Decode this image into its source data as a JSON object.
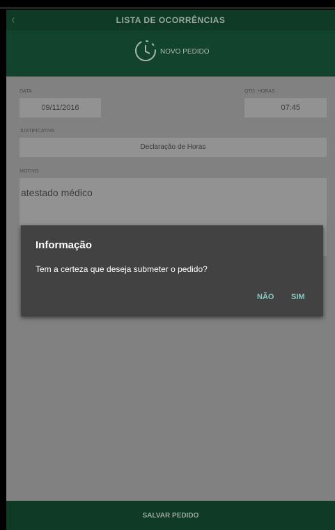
{
  "app": {
    "title": "LISTA DE OCORRÊNCIAS",
    "back_icon": "chevron-left-icon",
    "new_request_label": "NOVO PEDIDO",
    "new_request_icon": "clock-icon"
  },
  "form": {
    "date_label": "DATA",
    "date_value": "09/11/2016",
    "hours_label": "QTD. HORAS",
    "hours_value": "07:45",
    "justification_label": "JUSTIFICATIVA",
    "justification_value": "Declaração de Horas",
    "reason_label": "MOTIVO",
    "reason_value": "atestado médico"
  },
  "footer": {
    "save_label": "SALVAR PEDIDO"
  },
  "dialog": {
    "title": "Informação",
    "message": "Tem a certeza que deseja submeter o pedido?",
    "no_label": "NÃO",
    "yes_label": "SIM"
  },
  "colors": {
    "appbar": "#0e3a26",
    "subbar": "#12432d",
    "dim_background": "#818181",
    "dialog_background": "#424242",
    "dialog_accent": "#80cbc4"
  }
}
